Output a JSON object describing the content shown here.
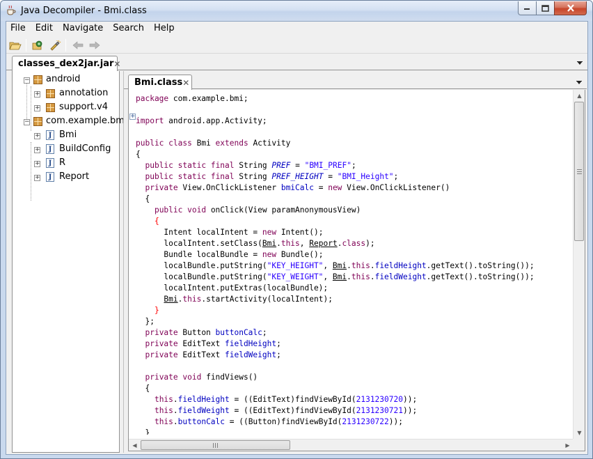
{
  "window": {
    "title": "Java Decompiler - Bmi.class",
    "app_icon": "coffee-cup-icon"
  },
  "menubar": {
    "items": [
      "File",
      "Edit",
      "Navigate",
      "Search",
      "Help"
    ]
  },
  "toolbar": {
    "buttons": [
      "open-file-icon",
      "open-type-icon",
      "open-type-hierarchy-icon",
      "back-icon",
      "forward-icon"
    ]
  },
  "outer_tab": {
    "label": "classes_dex2jar.jar"
  },
  "tree": {
    "nodes": [
      {
        "label": "android",
        "kind": "package",
        "expanded": true
      },
      {
        "label": "annotation",
        "kind": "package",
        "expanded": false
      },
      {
        "label": "support.v4",
        "kind": "package",
        "expanded": false
      },
      {
        "label": "com.example.bmi",
        "kind": "package",
        "expanded": true
      },
      {
        "label": "Bmi",
        "kind": "class",
        "expanded": false,
        "selected": true
      },
      {
        "label": "BuildConfig",
        "kind": "class",
        "expanded": false
      },
      {
        "label": "R",
        "kind": "class",
        "expanded": false
      },
      {
        "label": "Report",
        "kind": "class",
        "expanded": false
      }
    ]
  },
  "editor": {
    "tab_label": "Bmi.class",
    "code_lines": [
      "package com.example.bmi;",
      "",
      "import android.app.Activity;",
      "",
      "public class Bmi extends Activity",
      "{",
      "  public static final String PREF = \"BMI_PREF\";",
      "  public static final String PREF_HEIGHT = \"BMI_Height\";",
      "  private View.OnClickListener bmiCalc = new View.OnClickListener()",
      "  {",
      "    public void onClick(View paramAnonymousView)",
      "    {",
      "      Intent localIntent = new Intent();",
      "      localIntent.setClass(Bmi.this, Report.class);",
      "      Bundle localBundle = new Bundle();",
      "      localBundle.putString(\"KEY_HEIGHT\", Bmi.this.fieldHeight.getText().toString());",
      "      localBundle.putString(\"KEY_WEIGHT\", Bmi.this.fieldWeight.getText().toString());",
      "      localIntent.putExtras(localBundle);",
      "      Bmi.this.startActivity(localIntent);",
      "    }",
      "  };",
      "  private Button buttonCalc;",
      "  private EditText fieldHeight;",
      "  private EditText fieldWeight;",
      "",
      "  private void findViews()",
      "  {",
      "    this.fieldHeight = ((EditText)findViewById(2131230720));",
      "    this.fieldWeight = ((EditText)findViewById(2131230721));",
      "    this.buttonCalc = ((Button)findViewById(2131230722));",
      "  }"
    ]
  },
  "colors": {
    "keyword": "#7f0055",
    "string": "#2a00ff",
    "field": "#0000c0",
    "selection_brace": "#ff0000",
    "window_frame": "#c9d9ee",
    "close_button": "#c7452a"
  }
}
